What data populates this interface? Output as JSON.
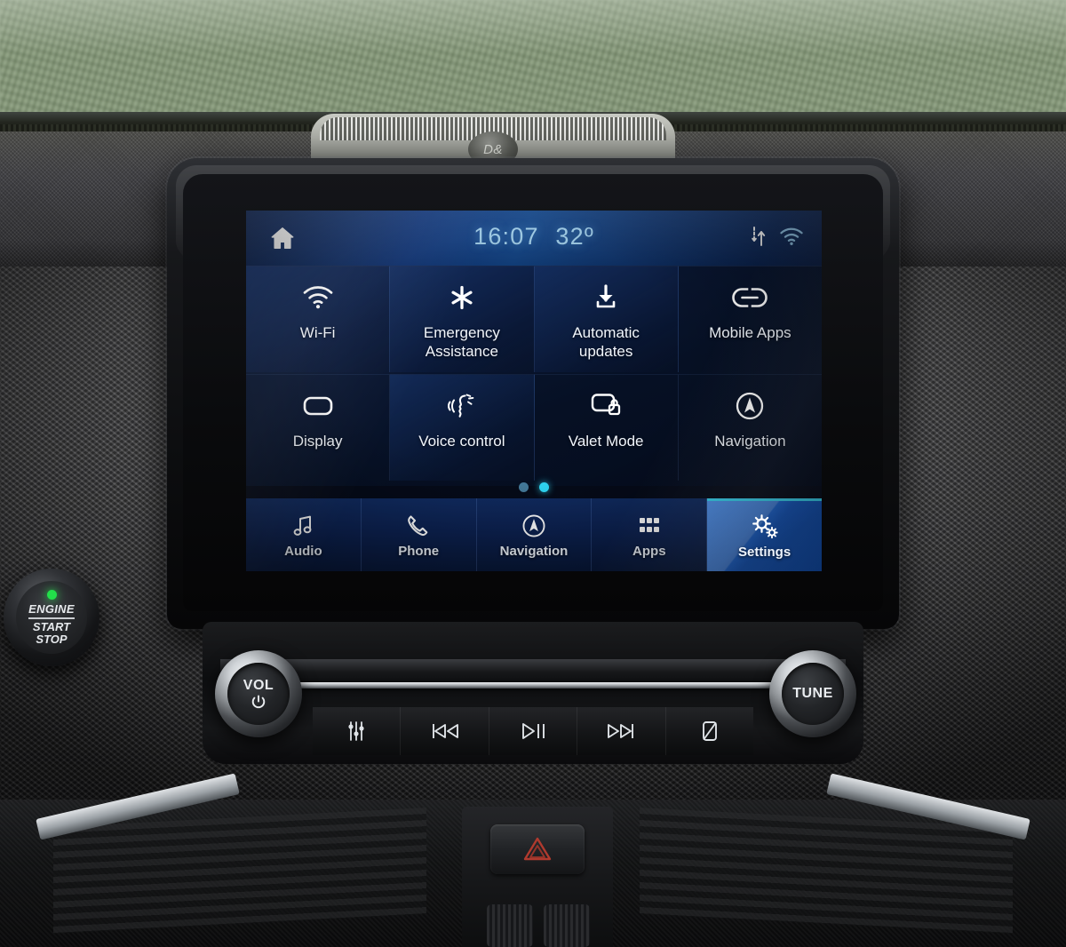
{
  "status_bar": {
    "home_icon": "home-icon",
    "time": "16:07",
    "temperature": "32º",
    "data_icon": "data-transfer-icon",
    "wifi_icon": "wifi-icon"
  },
  "settings_page": {
    "page_indicator": {
      "total": 2,
      "active": 2
    },
    "tiles": [
      {
        "label": "Wi-Fi",
        "icon": "wifi-icon",
        "lit": true
      },
      {
        "label": "Emergency\nAssistance",
        "icon": "star-of-life-icon",
        "lit": true
      },
      {
        "label": "Automatic\nupdates",
        "icon": "download-icon",
        "lit": true
      },
      {
        "label": "Mobile Apps",
        "icon": "link-icon",
        "lit": false
      },
      {
        "label": "Display",
        "icon": "screen-icon",
        "lit": false
      },
      {
        "label": "Voice control",
        "icon": "voice-icon",
        "lit": true
      },
      {
        "label": "Valet Mode",
        "icon": "screen-lock-icon",
        "lit": false
      },
      {
        "label": "Navigation",
        "icon": "compass-arrow-icon",
        "lit": false
      }
    ]
  },
  "nav_bar": {
    "items": [
      {
        "label": "Audio",
        "icon": "music-note-icon",
        "active": false
      },
      {
        "label": "Phone",
        "icon": "phone-icon",
        "active": false
      },
      {
        "label": "Navigation",
        "icon": "compass-arrow-icon",
        "active": false
      },
      {
        "label": "Apps",
        "icon": "grid-icon",
        "active": false
      },
      {
        "label": "Settings",
        "icon": "gears-icon",
        "active": true
      }
    ]
  },
  "hardware": {
    "volume_knob": "VOL",
    "tune_knob": "TUNE",
    "engine_button": {
      "line1": "ENGINE",
      "line2": "START",
      "line3": "STOP",
      "led": "green"
    },
    "media_buttons": [
      {
        "name": "audio-settings-button",
        "icon": "equalizer-icon"
      },
      {
        "name": "previous-track-button",
        "icon": "skip-back-icon"
      },
      {
        "name": "play-pause-button",
        "icon": "play-pause-icon"
      },
      {
        "name": "next-track-button",
        "icon": "skip-forward-icon"
      },
      {
        "name": "screen-off-button",
        "icon": "screen-off-icon"
      }
    ],
    "hazard_button": "hazard-triangle-icon",
    "speaker_badge": "D&"
  },
  "colors": {
    "accent_blue": "#1f6ad8",
    "accent_cyan": "#37d4f2",
    "status_text": "#a8d8f5",
    "screen_bg": "#050a18",
    "led_green": "#22e04a",
    "hazard_red": "#c0392b"
  }
}
